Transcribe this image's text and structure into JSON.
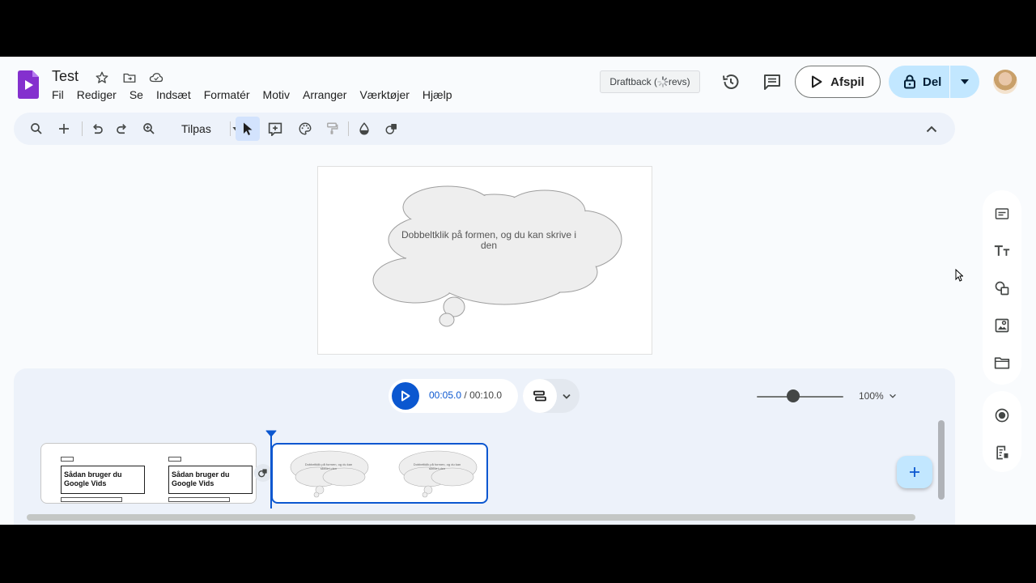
{
  "header": {
    "doc_title": "Test",
    "menu": [
      "Fil",
      "Rediger",
      "Se",
      "Indsæt",
      "Formatér",
      "Motiv",
      "Arranger",
      "Værktøjer",
      "Hjælp"
    ],
    "draftback_label": "Draftback (",
    "draftback_suffix": " revs)",
    "play_label": "Afspil",
    "share_label": "Del"
  },
  "toolbar": {
    "zoom_label": "Tilpas"
  },
  "slide": {
    "shape_text": "Dobbeltklik på formen, og du kan skrive i den"
  },
  "timeline": {
    "current_time": "00:05.0",
    "separator": " / ",
    "total_time": "00:10.0",
    "zoom_level": "100%",
    "zoom_fraction": 0.42,
    "clip1_title": "Sådan bruger du Google Vids",
    "clip2_text": "Dobbeltklik på formen, og du kan skrive i den"
  },
  "colors": {
    "accent": "#0b57d0",
    "share_bg": "#c2e7ff",
    "logo": "#8430ce"
  },
  "icons": {
    "toolbar": [
      "search-icon",
      "add-icon",
      "undo-icon",
      "redo-icon",
      "zoom-icon",
      "select-icon",
      "insert-box-icon",
      "palette-icon",
      "paint-format-icon",
      "fill-icon",
      "shape-effect-icon",
      "collapse-icon"
    ],
    "side_panel": [
      "scene-icon",
      "text-icon",
      "shapes-icon",
      "image-icon",
      "folder-icon",
      "record-icon",
      "script-icon"
    ]
  }
}
